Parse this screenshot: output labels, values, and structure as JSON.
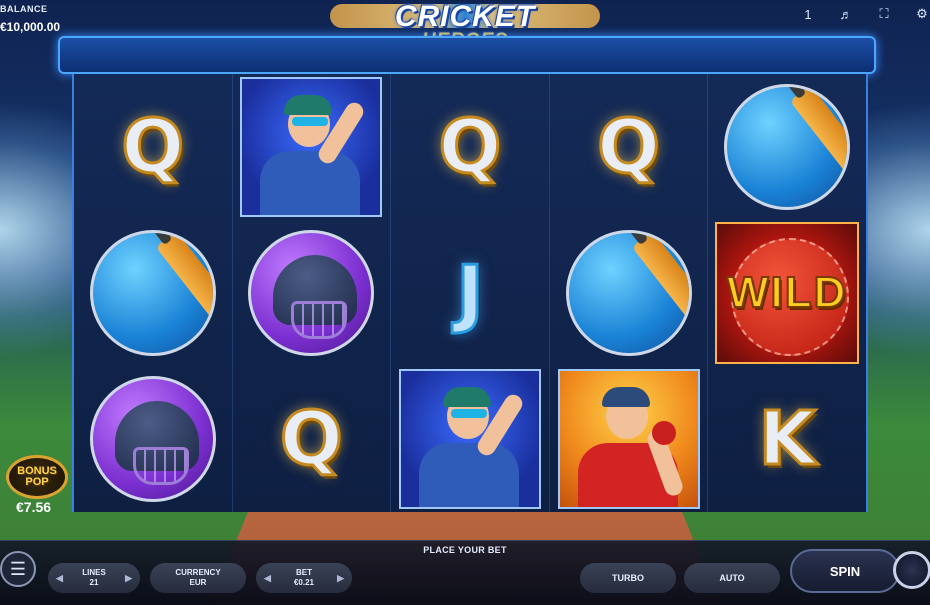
{
  "game": {
    "title": "CRICKET",
    "subtitle": "HEROES"
  },
  "balance": {
    "label": "BALANCE",
    "value": "€10,000.00"
  },
  "top_controls": {
    "counter": "1",
    "sound_icon": "speaker-icon",
    "fullscreen_icon": "fullscreen-icon",
    "settings_icon": "gear-icon"
  },
  "reels": [
    [
      "Q",
      "bat",
      "helmet"
    ],
    [
      "player-blue",
      "helmet",
      "Q"
    ],
    [
      "Q",
      "J",
      "player-blue"
    ],
    [
      "Q",
      "bat",
      "player-red"
    ],
    [
      "bat",
      "WILD",
      "K"
    ]
  ],
  "wild_label": "WILD",
  "bonus": {
    "line1": "BONUS",
    "line2": "POP",
    "value": "€7.56"
  },
  "bottom_bar": {
    "place_bet": "PLACE YOUR BET",
    "menu_icon": "hamburger-icon",
    "lines_label": "LINES",
    "lines_value": "21",
    "currency_label": "CURRENCY",
    "currency_value": "EUR",
    "bet_label": "BET",
    "bet_value": "€0.21",
    "turbo": "TURBO",
    "auto": "AUTO",
    "spin": "SPIN"
  },
  "colors": {
    "accent": "#3b8cff",
    "gold": "#ffd23a",
    "wild_red": "#c81f1f"
  }
}
